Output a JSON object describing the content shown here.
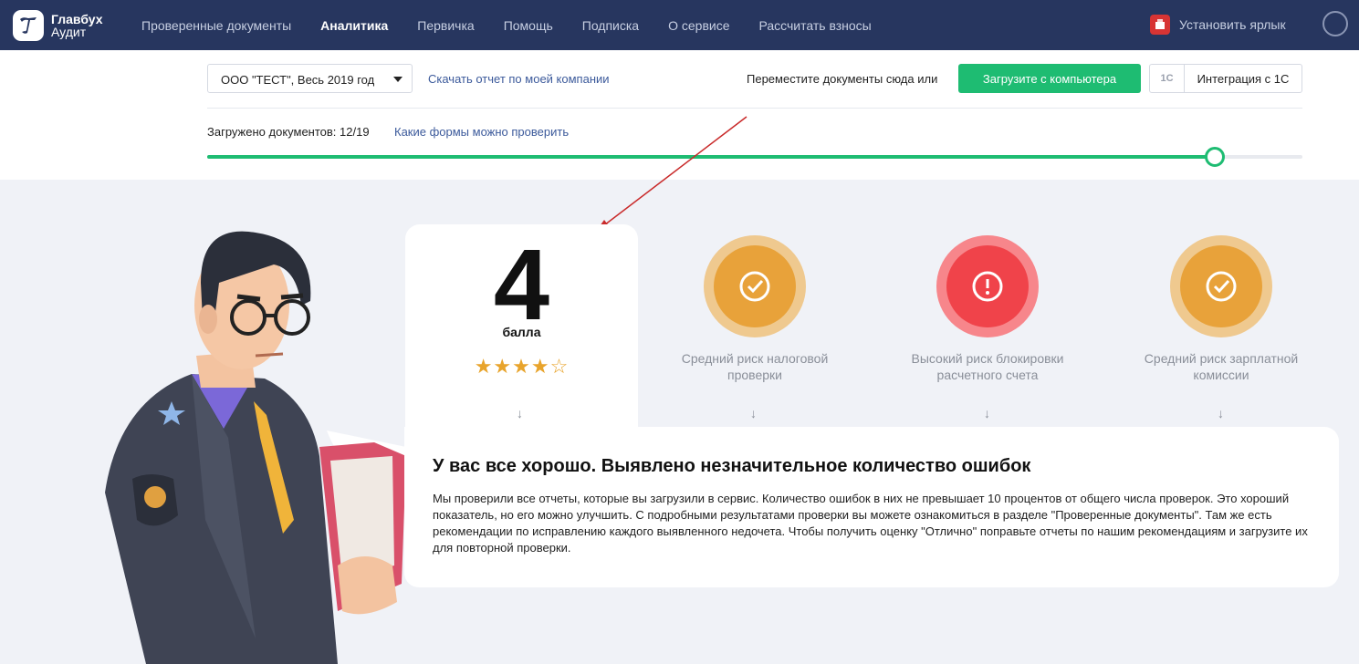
{
  "nav": {
    "logo_line1": "Главбух",
    "logo_line2": "Аудит",
    "links": [
      "Проверенные документы",
      "Аналитика",
      "Первичка",
      "Помощь",
      "Подписка",
      "О сервисе",
      "Рассчитать взносы"
    ],
    "active_link": "Аналитика",
    "install_shortcut": "Установить ярлык",
    "user_icon": "user-circle-icon"
  },
  "toolbar": {
    "company_select": "ООО \"ТЕСТ\",  Весь 2019 год",
    "download_report_link": "Скачать отчет по моей компании",
    "drop_text": "Переместите документы сюда или",
    "upload_button": "Загрузите с компьютера",
    "integration_icon": "1С",
    "integration_button": "Интеграция с 1С"
  },
  "progress": {
    "loaded_label": "Загружено документов: 12/19",
    "loaded": 12,
    "total": 19,
    "forms_link": "Какие формы можно проверить"
  },
  "score": {
    "value": "4",
    "unit": "балла",
    "stars": "★★★★☆",
    "rating": 4,
    "max_rating": 5
  },
  "risks": [
    {
      "text": "Средний риск налоговой проверки",
      "level": "medium",
      "icon": "check-icon"
    },
    {
      "text": "Высокий риск блокировки расчетного счета",
      "level": "high",
      "icon": "exclamation-icon"
    },
    {
      "text": "Средний риск зарплатной комиссии",
      "level": "medium",
      "icon": "check-icon"
    }
  ],
  "colors": {
    "nav_bg": "#27365f",
    "accent_green": "#1ebc72",
    "medium_risk": "#e8a23a",
    "high_risk": "#f0434a"
  },
  "result": {
    "title": "У вас все хорошо. Выявлено незначительное количество ошибок",
    "body": "Мы проверили все отчеты, которые вы загрузили в сервис. Количество ошибок в них не превышает 10 процентов от общего числа проверок. Это хороший показатель, но его можно улучшить. С подробными результатами проверки вы можете ознакомиться в разделе \"Проверенные документы\". Там же есть рекомендации по исправлению каждого выявленного недочета. Чтобы получить оценку \"Отлично\" поправьте отчеты по нашим рекомендациям и загрузите их для повторной проверки."
  }
}
